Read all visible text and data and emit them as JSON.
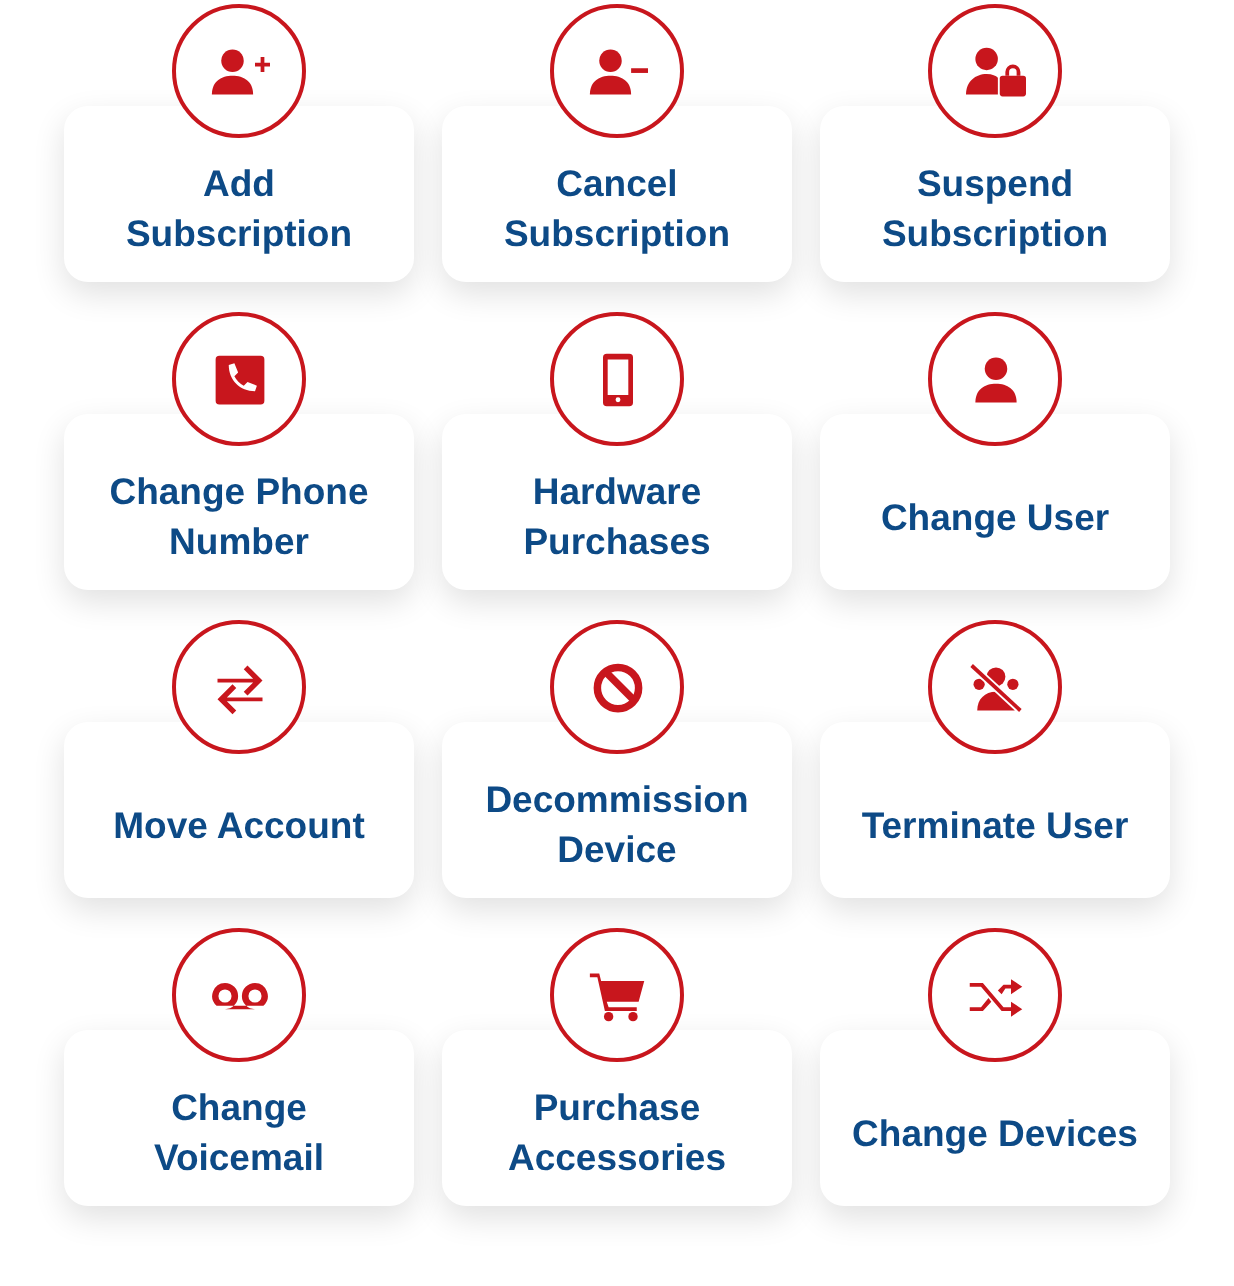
{
  "tiles": [
    {
      "lines": [
        "Add",
        "Subscription"
      ]
    },
    {
      "lines": [
        "Cancel",
        "Subscription"
      ]
    },
    {
      "lines": [
        "Suspend",
        "Subscription"
      ]
    },
    {
      "lines": [
        "Change Phone",
        "Number"
      ]
    },
    {
      "lines": [
        "Hardware",
        "Purchases"
      ]
    },
    {
      "lines": [
        "Change User"
      ]
    },
    {
      "lines": [
        "Move Account"
      ]
    },
    {
      "lines": [
        "Decommission",
        "Device"
      ]
    },
    {
      "lines": [
        "Terminate User"
      ]
    },
    {
      "lines": [
        "Change",
        "Voicemail"
      ]
    },
    {
      "lines": [
        "Purchase",
        "Accessories"
      ]
    },
    {
      "lines": [
        "Change Devices"
      ]
    }
  ]
}
